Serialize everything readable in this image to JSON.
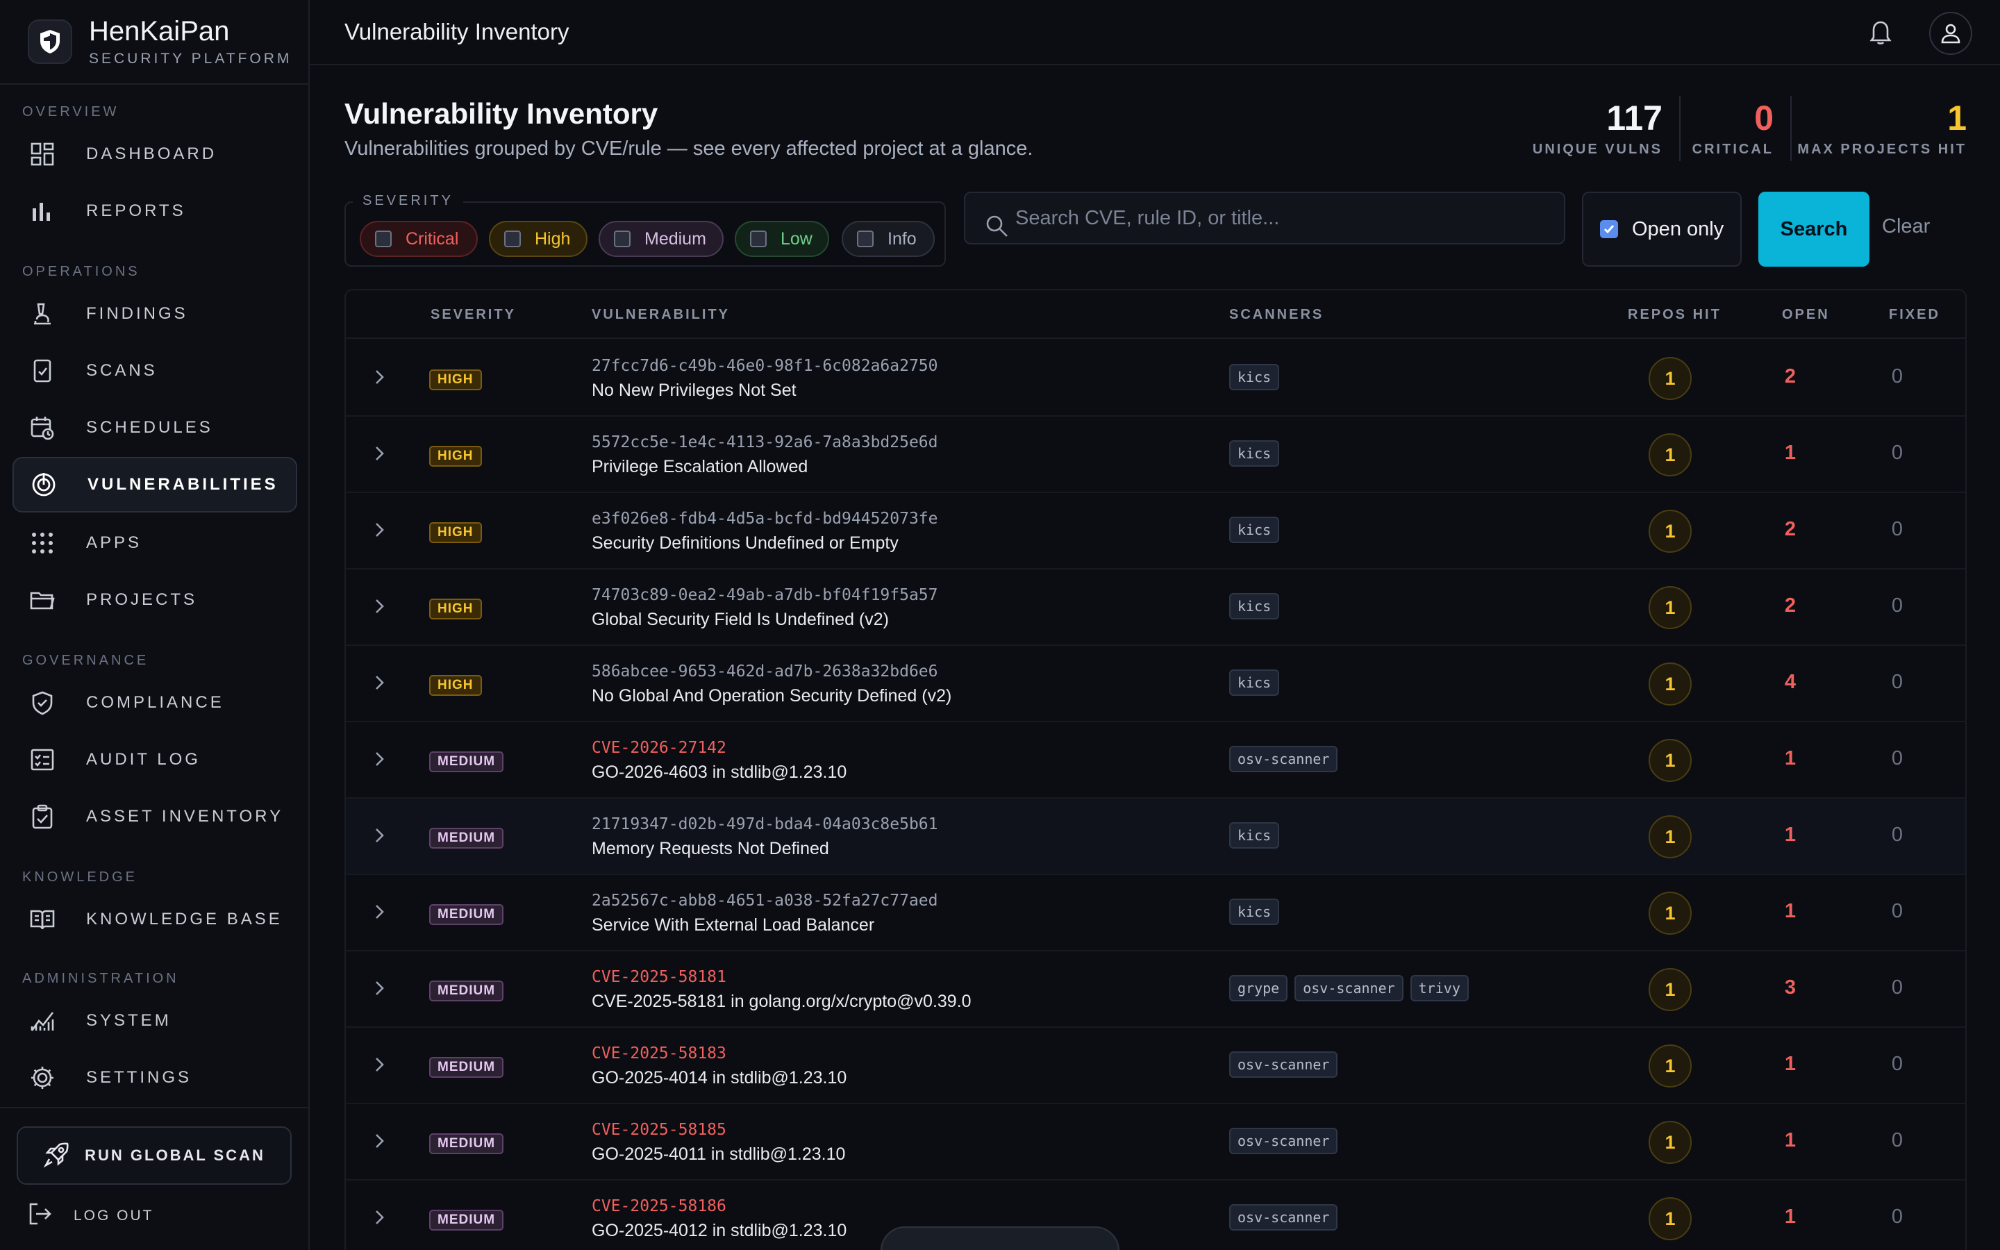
{
  "brand": {
    "name": "HenKaiPan",
    "sub": "SECURITY PLATFORM"
  },
  "sidebar": {
    "sections": [
      "OVERVIEW",
      "OPERATIONS",
      "GOVERNANCE",
      "KNOWLEDGE",
      "ADMINISTRATION"
    ],
    "items": [
      {
        "label": "DASHBOARD",
        "icon": "dashboard-icon"
      },
      {
        "label": "REPORTS",
        "icon": "bar-chart-icon"
      },
      {
        "label": "FINDINGS",
        "icon": "microscope-icon"
      },
      {
        "label": "SCANS",
        "icon": "document-check-icon"
      },
      {
        "label": "SCHEDULES",
        "icon": "calendar-refresh-icon"
      },
      {
        "label": "VULNERABILITIES",
        "icon": "target-icon"
      },
      {
        "label": "APPS",
        "icon": "grid-dots-icon"
      },
      {
        "label": "PROJECTS",
        "icon": "folder-icon"
      },
      {
        "label": "COMPLIANCE",
        "icon": "shield-check-icon"
      },
      {
        "label": "AUDIT LOG",
        "icon": "checklist-icon"
      },
      {
        "label": "ASSET INVENTORY",
        "icon": "clipboard-check-icon"
      },
      {
        "label": "KNOWLEDGE BASE",
        "icon": "book-icon"
      },
      {
        "label": "SYSTEM",
        "icon": "trend-chart-icon"
      },
      {
        "label": "SETTINGS",
        "icon": "gear-icon"
      }
    ],
    "active": "VULNERABILITIES",
    "run_scan": "RUN GLOBAL SCAN",
    "logout": "LOG OUT"
  },
  "topbar": {
    "title": "Vulnerability Inventory"
  },
  "header": {
    "title": "Vulnerability Inventory",
    "subtitle": "Vulnerabilities grouped by CVE/rule — see every affected project at a glance."
  },
  "stats": [
    {
      "value": "117",
      "label": "UNIQUE VULNS",
      "color": "#f4f5f8"
    },
    {
      "value": "0",
      "label": "CRITICAL",
      "color": "#f0605d"
    },
    {
      "value": "1",
      "label": "MAX PROJECTS HIT",
      "color": "#f7c530"
    }
  ],
  "filters": {
    "severity_legend": "SEVERITY",
    "chips": [
      {
        "label": "Critical",
        "color": "#f0605d",
        "bg": "#2a1214",
        "border": "#5c2226"
      },
      {
        "label": "High",
        "color": "#f7c530",
        "bg": "#2a2108",
        "border": "#5a4610"
      },
      {
        "label": "Medium",
        "color": "#d8bfe3",
        "bg": "#231b29",
        "border": "#4a3a54"
      },
      {
        "label": "Low",
        "color": "#6fd08a",
        "bg": "#112318",
        "border": "#24492f"
      },
      {
        "label": "Info",
        "color": "#a9b0bf",
        "bg": "#171a21",
        "border": "#2e3340"
      }
    ],
    "search_placeholder": "Search CVE, rule ID, or title...",
    "open_only": "Open only",
    "search_button": "Search",
    "clear_button": "Clear"
  },
  "table": {
    "headers": [
      "SEVERITY",
      "VULNERABILITY",
      "SCANNERS",
      "REPOS HIT",
      "OPEN",
      "FIXED"
    ],
    "rows": [
      {
        "severity": "HIGH",
        "id": "27fcc7d6-c49b-46e0-98f1-6c082a6a2750",
        "cve": false,
        "title": "No New Privileges Not Set",
        "scanners": [
          "kics"
        ],
        "repos": "1",
        "open": "2",
        "fixed": "0"
      },
      {
        "severity": "HIGH",
        "id": "5572cc5e-1e4c-4113-92a6-7a8a3bd25e6d",
        "cve": false,
        "title": "Privilege Escalation Allowed",
        "scanners": [
          "kics"
        ],
        "repos": "1",
        "open": "1",
        "fixed": "0"
      },
      {
        "severity": "HIGH",
        "id": "e3f026e8-fdb4-4d5a-bcfd-bd94452073fe",
        "cve": false,
        "title": "Security Definitions Undefined or Empty",
        "scanners": [
          "kics"
        ],
        "repos": "1",
        "open": "2",
        "fixed": "0"
      },
      {
        "severity": "HIGH",
        "id": "74703c89-0ea2-49ab-a7db-bf04f19f5a57",
        "cve": false,
        "title": "Global Security Field Is Undefined (v2)",
        "scanners": [
          "kics"
        ],
        "repos": "1",
        "open": "2",
        "fixed": "0"
      },
      {
        "severity": "HIGH",
        "id": "586abcee-9653-462d-ad7b-2638a32bd6e6",
        "cve": false,
        "title": "No Global And Operation Security Defined (v2)",
        "scanners": [
          "kics"
        ],
        "repos": "1",
        "open": "4",
        "fixed": "0"
      },
      {
        "severity": "MEDIUM",
        "id": "CVE-2026-27142",
        "cve": true,
        "title": "GO-2026-4603 in stdlib@1.23.10",
        "scanners": [
          "osv-scanner"
        ],
        "repos": "1",
        "open": "1",
        "fixed": "0"
      },
      {
        "severity": "MEDIUM",
        "id": "21719347-d02b-497d-bda4-04a03c8e5b61",
        "cve": false,
        "title": "Memory Requests Not Defined",
        "scanners": [
          "kics"
        ],
        "repos": "1",
        "open": "1",
        "fixed": "0"
      },
      {
        "severity": "MEDIUM",
        "id": "2a52567c-abb8-4651-a038-52fa27c77aed",
        "cve": false,
        "title": "Service With External Load Balancer",
        "scanners": [
          "kics"
        ],
        "repos": "1",
        "open": "1",
        "fixed": "0"
      },
      {
        "severity": "MEDIUM",
        "id": "CVE-2025-58181",
        "cve": true,
        "title": "CVE-2025-58181 in golang.org/x/crypto@v0.39.0",
        "scanners": [
          "grype",
          "osv-scanner",
          "trivy"
        ],
        "repos": "1",
        "open": "3",
        "fixed": "0"
      },
      {
        "severity": "MEDIUM",
        "id": "CVE-2025-58183",
        "cve": true,
        "title": "GO-2025-4014 in stdlib@1.23.10",
        "scanners": [
          "osv-scanner"
        ],
        "repos": "1",
        "open": "1",
        "fixed": "0"
      },
      {
        "severity": "MEDIUM",
        "id": "CVE-2025-58185",
        "cve": true,
        "title": "GO-2025-4011 in stdlib@1.23.10",
        "scanners": [
          "osv-scanner"
        ],
        "repos": "1",
        "open": "1",
        "fixed": "0"
      },
      {
        "severity": "MEDIUM",
        "id": "CVE-2025-58186",
        "cve": true,
        "title": "GO-2025-4012 in stdlib@1.23.10",
        "scanners": [
          "osv-scanner"
        ],
        "repos": "1",
        "open": "1",
        "fixed": "0"
      }
    ]
  }
}
